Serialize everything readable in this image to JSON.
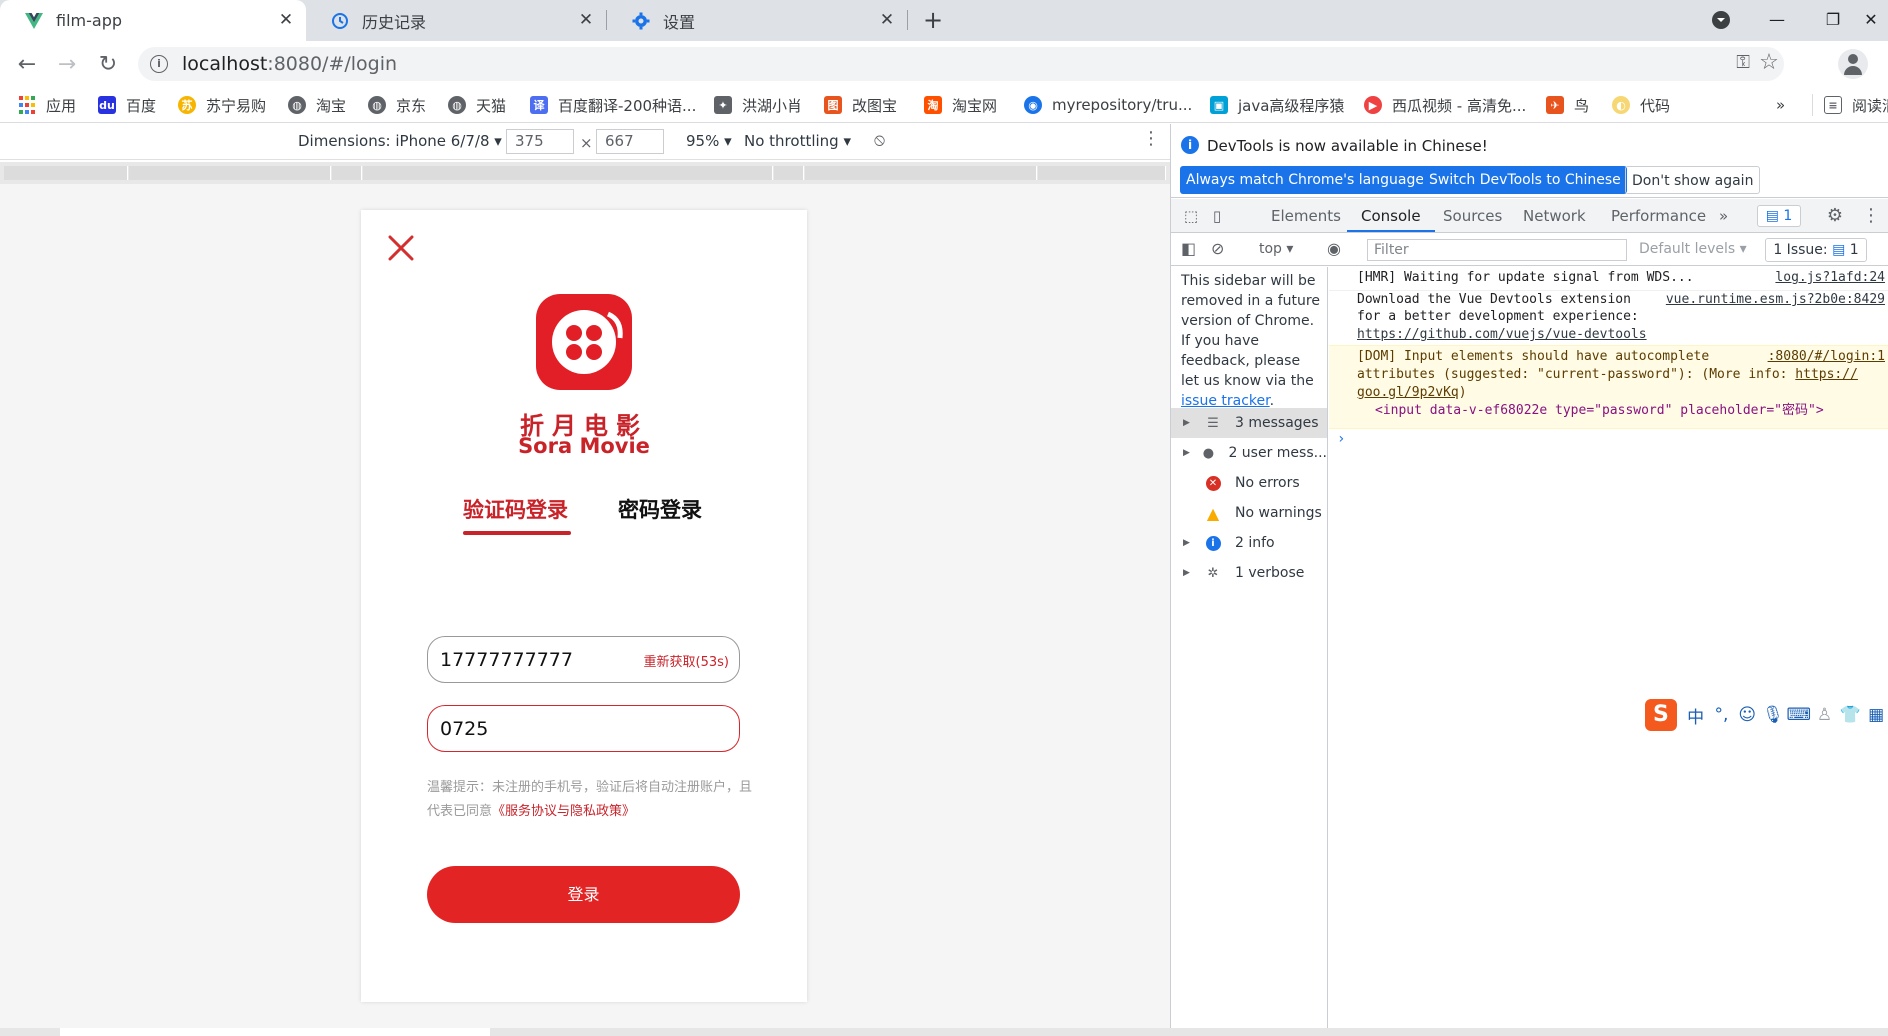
{
  "browser": {
    "tabs": [
      {
        "title": "film-app",
        "icon": "vue-icon"
      },
      {
        "title": "历史记录",
        "icon": "history-icon"
      },
      {
        "title": "设置",
        "icon": "gear-icon"
      }
    ],
    "url": {
      "host": "localhost",
      "rest": ":8080/#/login"
    },
    "bookmarks": [
      {
        "label": "应用",
        "color": "#1a73e8"
      },
      {
        "label": "百度",
        "color": "#2932e1"
      },
      {
        "label": "苏宁易购",
        "color": "#f7b500"
      },
      {
        "label": "淘宝",
        "color": "#5f6368"
      },
      {
        "label": "京东",
        "color": "#5f6368"
      },
      {
        "label": "天猫",
        "color": "#5f6368"
      },
      {
        "label": "百度翻译-200种语...",
        "color": "#4e6ef2"
      },
      {
        "label": "洪湖小肖",
        "color": "#5f6368"
      },
      {
        "label": "改图宝",
        "color": "#e8541e"
      },
      {
        "label": "淘宝网",
        "color": "#ff5000"
      },
      {
        "label": "myrepository/tru...",
        "color": "#1a73e8"
      },
      {
        "label": "java高级程序猿",
        "color": "#00a1d6"
      },
      {
        "label": "西瓜视频 - 高清免...",
        "color": "#f04142"
      },
      {
        "label": "鸟",
        "color": "#e8541e"
      },
      {
        "label": "代码",
        "color": "#f7d774"
      }
    ],
    "bookmarks_overflow": "»",
    "reading_list": "阅读清"
  },
  "device_toolbar": {
    "dimensions_label": "Dimensions: iPhone 6/7/8",
    "width": "375",
    "times": "×",
    "height": "667",
    "zoom": "95%",
    "throttling": "No throttling"
  },
  "app": {
    "brand_cn": "折月电影",
    "brand_en": "Sora Movie",
    "tab_code": "验证码登录",
    "tab_password": "密码登录",
    "phone_value": "17777777777",
    "resend_label": "重新获取(53s)",
    "code_value": "0725",
    "hint_text": "温馨提示：未注册的手机号，验证后将自动注册账户，且代表已同意",
    "hint_link": "《服务协议与隐私政策》",
    "login_label": "登录",
    "brand_color": "#e22424"
  },
  "devtools": {
    "banner_text": "DevTools is now available in Chinese!",
    "btn_match": "Always match Chrome's language",
    "btn_switch": "Switch DevTools to Chinese",
    "btn_dismiss": "Don't show again",
    "tabs": [
      "Elements",
      "Console",
      "Sources",
      "Network",
      "Performance"
    ],
    "tabs_more": "»",
    "message_count": "1",
    "context": "top",
    "filter_placeholder": "Filter",
    "levels": "Default levels",
    "issues": "1 Issue:",
    "issues_count": "1",
    "sidebar_notice": "This sidebar will be removed in a future version of Chrome. If you have feedback, please let us know via the",
    "sidebar_notice_link": "issue tracker",
    "sidebar_notice_end": ".",
    "sidebar_items": [
      {
        "label": "3 messages",
        "icon": "list-icon"
      },
      {
        "label": "2 user mess...",
        "icon": "user-icon"
      },
      {
        "label": "No errors",
        "icon": "error-icon"
      },
      {
        "label": "No warnings",
        "icon": "warning-icon"
      },
      {
        "label": "2 info",
        "icon": "info-icon"
      },
      {
        "label": "1 verbose",
        "icon": "bug-icon"
      }
    ],
    "logs": {
      "hmr": "[HMR] Waiting for update signal from WDS...",
      "hmr_src": "log.js?1afd:24",
      "vue_1": "Download the Vue Devtools extension",
      "vue_src": "vue.runtime.esm.js?2b0e:8429",
      "vue_2": "for a better development experience:",
      "vue_link": "https://github.com/vuejs/vue-devtools",
      "dom_1": "[DOM] Input elements should have autocomplete",
      "dom_src": ":8080/#/login:1",
      "dom_2": "attributes (suggested: \"current-password\"): (More info:",
      "dom_2_link": "https://",
      "dom_3_link": "goo.gl/9p2vKq",
      "dom_3_end": ")",
      "dom_element": "<input data-v-ef68022e type=\"password\" placeholder=\"密码\">"
    }
  }
}
